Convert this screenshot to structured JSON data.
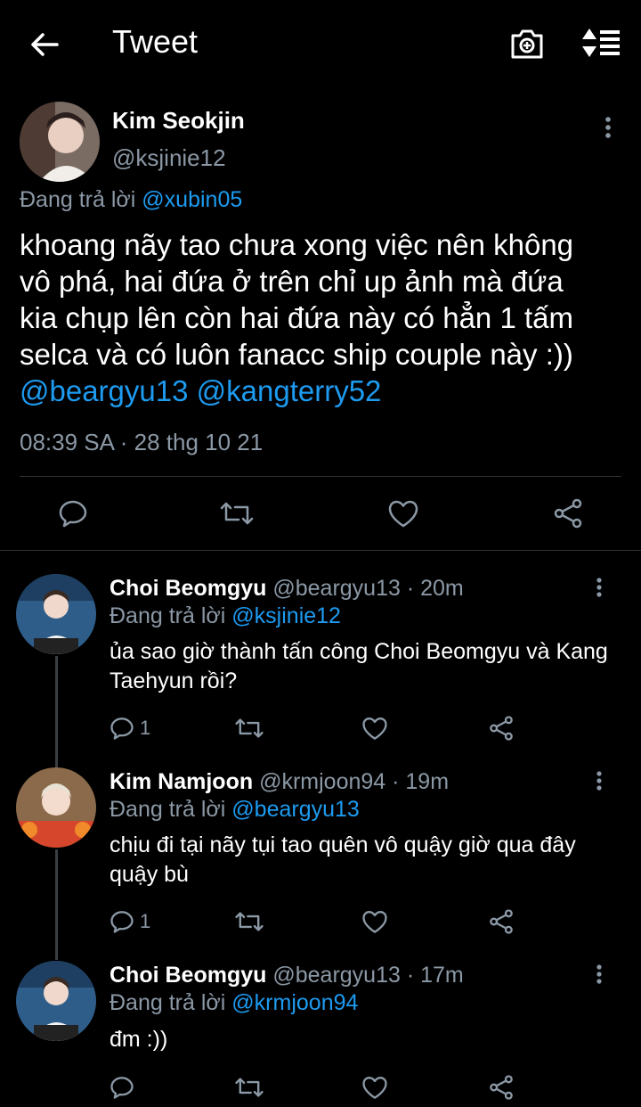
{
  "header": {
    "title": "Tweet"
  },
  "main_tweet": {
    "name": "Kim Seokjin",
    "handle": "@ksjinie12",
    "replying_prefix": "Đang trả lời",
    "replying_to": "@xubin05",
    "text_lines": [
      "khoang nãy tao chưa xong việc nên không",
      "vô phá, hai đứa ở trên chỉ up ảnh mà đứa",
      "kia chụp lên còn hai đứa này có hẳn 1 tấm",
      "selca và có luôn fanacc ship couple này :))"
    ],
    "mention_1": "@beargyu13",
    "mention_2": "@kangterry52",
    "timestamp": "08:39 SA · 28 thg 10 21"
  },
  "replies": [
    {
      "name": "Choi Beomgyu",
      "meta": "@beargyu13 · 20m",
      "replying_prefix": "Đang trả lời",
      "replying_to": "@ksjinie12",
      "text": "ủa sao giờ thành tấn công Choi Beomgyu và Kang Taehyun rồi?",
      "reply_count": "1"
    },
    {
      "name": "Kim Namjoon",
      "meta": "@krmjoon94 · 19m",
      "replying_prefix": "Đang trả lời",
      "replying_to": "@beargyu13",
      "text": "chịu đi tại nãy tụi tao quên vô quậy giờ qua đây quậy bù",
      "reply_count": "1"
    },
    {
      "name": "Choi Beomgyu",
      "meta": "@beargyu13 · 17m",
      "replying_prefix": "Đang trả lời",
      "replying_to": "@krmjoon94",
      "text": "đm :))"
    }
  ],
  "colors": {
    "background": "#000000",
    "link": "#1d9bf0",
    "muted": "#8b98a5",
    "divider": "#2f3336"
  }
}
